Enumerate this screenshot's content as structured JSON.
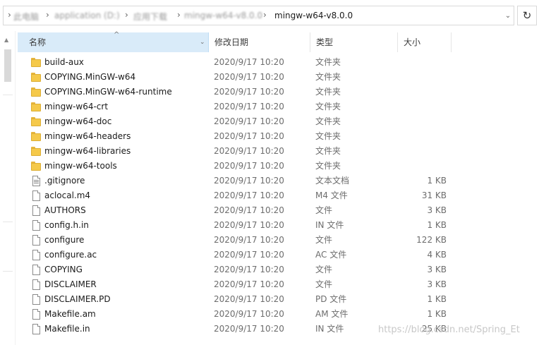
{
  "address_bar": {
    "crumbs": [
      {
        "label": "此电脑",
        "blurred": true
      },
      {
        "label": "application (D:)",
        "blurred": true
      },
      {
        "label": "应用下载",
        "blurred": true
      },
      {
        "label": "mingw-w64-v8.0.0",
        "blurred": true
      },
      {
        "label": "mingw-w64-v8.0.0",
        "blurred": false
      }
    ],
    "separator": "›",
    "dropdown_glyph": "⌄",
    "refresh_glyph": "↻"
  },
  "columns": {
    "name": "名称",
    "date": "修改日期",
    "type": "类型",
    "size": "大小",
    "sort_glyph": "^",
    "dropdown_glyph": "⌄"
  },
  "files": [
    {
      "name": "build-aux",
      "date": "2020/9/17 10:20",
      "type": "文件夹",
      "size": "",
      "kind": "folder"
    },
    {
      "name": "COPYING.MinGW-w64",
      "date": "2020/9/17 10:20",
      "type": "文件夹",
      "size": "",
      "kind": "folder"
    },
    {
      "name": "COPYING.MinGW-w64-runtime",
      "date": "2020/9/17 10:20",
      "type": "文件夹",
      "size": "",
      "kind": "folder"
    },
    {
      "name": "mingw-w64-crt",
      "date": "2020/9/17 10:20",
      "type": "文件夹",
      "size": "",
      "kind": "folder"
    },
    {
      "name": "mingw-w64-doc",
      "date": "2020/9/17 10:20",
      "type": "文件夹",
      "size": "",
      "kind": "folder"
    },
    {
      "name": "mingw-w64-headers",
      "date": "2020/9/17 10:20",
      "type": "文件夹",
      "size": "",
      "kind": "folder"
    },
    {
      "name": "mingw-w64-libraries",
      "date": "2020/9/17 10:20",
      "type": "文件夹",
      "size": "",
      "kind": "folder"
    },
    {
      "name": "mingw-w64-tools",
      "date": "2020/9/17 10:20",
      "type": "文件夹",
      "size": "",
      "kind": "folder"
    },
    {
      "name": ".gitignore",
      "date": "2020/9/17 10:20",
      "type": "文本文档",
      "size": "1 KB",
      "kind": "text"
    },
    {
      "name": "aclocal.m4",
      "date": "2020/9/17 10:20",
      "type": "M4 文件",
      "size": "31 KB",
      "kind": "file"
    },
    {
      "name": "AUTHORS",
      "date": "2020/9/17 10:20",
      "type": "文件",
      "size": "3 KB",
      "kind": "file"
    },
    {
      "name": "config.h.in",
      "date": "2020/9/17 10:20",
      "type": "IN 文件",
      "size": "1 KB",
      "kind": "file"
    },
    {
      "name": "configure",
      "date": "2020/9/17 10:20",
      "type": "文件",
      "size": "122 KB",
      "kind": "file"
    },
    {
      "name": "configure.ac",
      "date": "2020/9/17 10:20",
      "type": "AC 文件",
      "size": "4 KB",
      "kind": "file"
    },
    {
      "name": "COPYING",
      "date": "2020/9/17 10:20",
      "type": "文件",
      "size": "3 KB",
      "kind": "file"
    },
    {
      "name": "DISCLAIMER",
      "date": "2020/9/17 10:20",
      "type": "文件",
      "size": "3 KB",
      "kind": "file"
    },
    {
      "name": "DISCLAIMER.PD",
      "date": "2020/9/17 10:20",
      "type": "PD 文件",
      "size": "1 KB",
      "kind": "file"
    },
    {
      "name": "Makefile.am",
      "date": "2020/9/17 10:20",
      "type": "AM 文件",
      "size": "1 KB",
      "kind": "file"
    },
    {
      "name": "Makefile.in",
      "date": "2020/9/17 10:20",
      "type": "IN 文件",
      "size": "25 KB",
      "kind": "file"
    }
  ],
  "watermark": "https://blog.csdn.net/Spring_Et",
  "colors": {
    "header_selected_bg": "#d9ebf9",
    "folder_yellow": "#f5c94a",
    "secondary_text": "#6d6d6d"
  }
}
